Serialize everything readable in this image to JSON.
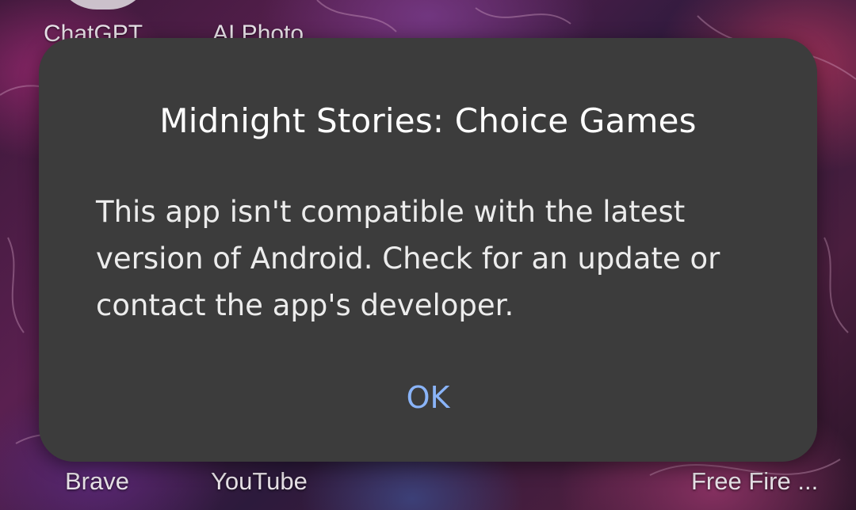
{
  "home_screen": {
    "top_row_apps": [
      "ChatGPT",
      "AI Photo"
    ],
    "bottom_row_apps": [
      "Brave",
      "YouTube",
      "Free Fire ..."
    ]
  },
  "dialog": {
    "title": "Midnight Stories: Choice Games",
    "message": "This app isn't compatible with the latest version of Android. Check for an update or contact the app's developer.",
    "ok_label": "OK"
  },
  "colors": {
    "dialog_background": "#3c3c3c",
    "button_accent": "#8ab4f8",
    "title_text": "#ffffff"
  }
}
